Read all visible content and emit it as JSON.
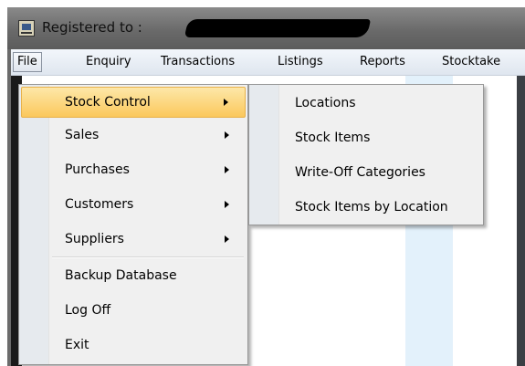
{
  "window": {
    "title": "Registered to :"
  },
  "menubar": {
    "items": [
      "File",
      "Enquiry",
      "Transactions",
      "Listings",
      "Reports",
      "Stocktake"
    ]
  },
  "file_menu": {
    "items": [
      "Stock Control",
      "Sales",
      "Purchases",
      "Customers",
      "Suppliers",
      "Backup Database",
      "Log Off",
      "Exit"
    ]
  },
  "stock_control_submenu": {
    "items": [
      "Locations",
      "Stock Items",
      "Write-Off Categories",
      "Stock Items by Location"
    ]
  },
  "colors": {
    "highlight": "#fbc85c",
    "menu_background": "#f0f0f0",
    "menubar_background": "#dfe6ef"
  }
}
